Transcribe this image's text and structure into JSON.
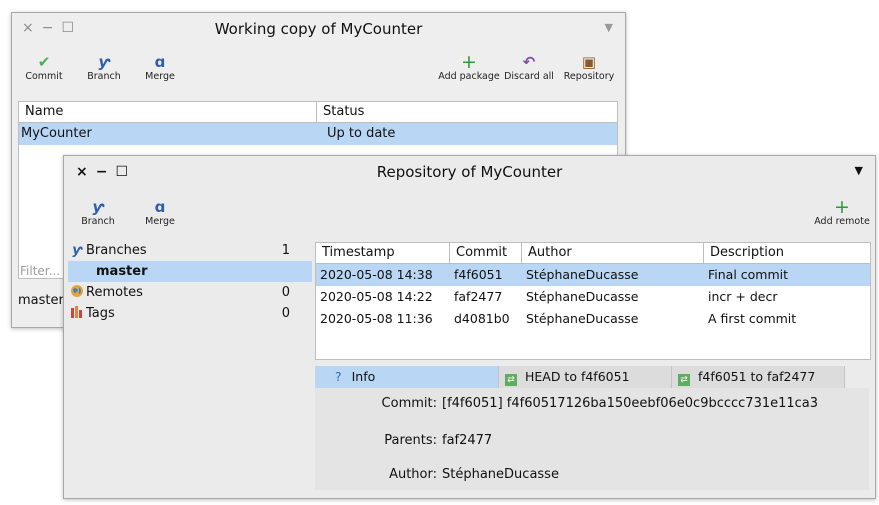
{
  "working_copy": {
    "title": "Working copy of MyCounter",
    "window_controls": {
      "close": "×",
      "minimize": "−",
      "maximize": "☐",
      "menu": "▼"
    },
    "toolbar": {
      "commit": "Commit",
      "branch": "Branch",
      "merge": "Merge",
      "add_package": "Add package",
      "discard_all": "Discard all",
      "repository": "Repository"
    },
    "table": {
      "columns": [
        "Name",
        "Status"
      ],
      "rows": [
        {
          "name": "MyCounter",
          "status": "Up to date"
        }
      ]
    },
    "filter_placeholder": "Filter...",
    "branch_label": "master"
  },
  "repository": {
    "title": "Repository of MyCounter",
    "window_controls": {
      "close": "×",
      "minimize": "−",
      "maximize": "☐",
      "menu": "▼"
    },
    "toolbar": {
      "branch": "Branch",
      "merge": "Merge",
      "add_remote": "Add remote"
    },
    "sidebar": [
      {
        "label": "Branches",
        "count": "1",
        "icon": "branch-icon"
      },
      {
        "label": "master",
        "count": "",
        "icon": ""
      },
      {
        "label": "Remotes",
        "count": "0",
        "icon": "globe-icon"
      },
      {
        "label": "Tags",
        "count": "0",
        "icon": "tags-icon"
      }
    ],
    "commits": {
      "columns": [
        "Timestamp",
        "Commit",
        "Author",
        "Description"
      ],
      "rows": [
        {
          "timestamp": "2020-05-08 14:38",
          "commit": "f4f6051",
          "author": "StéphaneDucasse",
          "description": "Final commit"
        },
        {
          "timestamp": "2020-05-08 14:22",
          "commit": "faf2477",
          "author": "StéphaneDucasse",
          "description": "incr + decr"
        },
        {
          "timestamp": "2020-05-08 11:36",
          "commit": "d4081b0",
          "author": "StéphaneDucasse",
          "description": "A first commit"
        }
      ]
    },
    "tabs": [
      "Info",
      "HEAD to f4f6051",
      "f4f6051 to faf2477"
    ],
    "info": {
      "commit_label": "Commit:",
      "commit_value": "[f4f6051] f4f60517126ba150eebf06e0c9bcccc731e11ca3",
      "parents_label": "Parents:",
      "parents_value": "faf2477",
      "author_label": "Author:",
      "author_value": "StéphaneDucasse"
    }
  },
  "colors": {
    "selection": "#b9d7f5",
    "commit_green": "#4caf50",
    "branch_blue": "#2f5fa8",
    "discard_purple": "#7b4fa0",
    "add_green": "#2e9a3e"
  }
}
